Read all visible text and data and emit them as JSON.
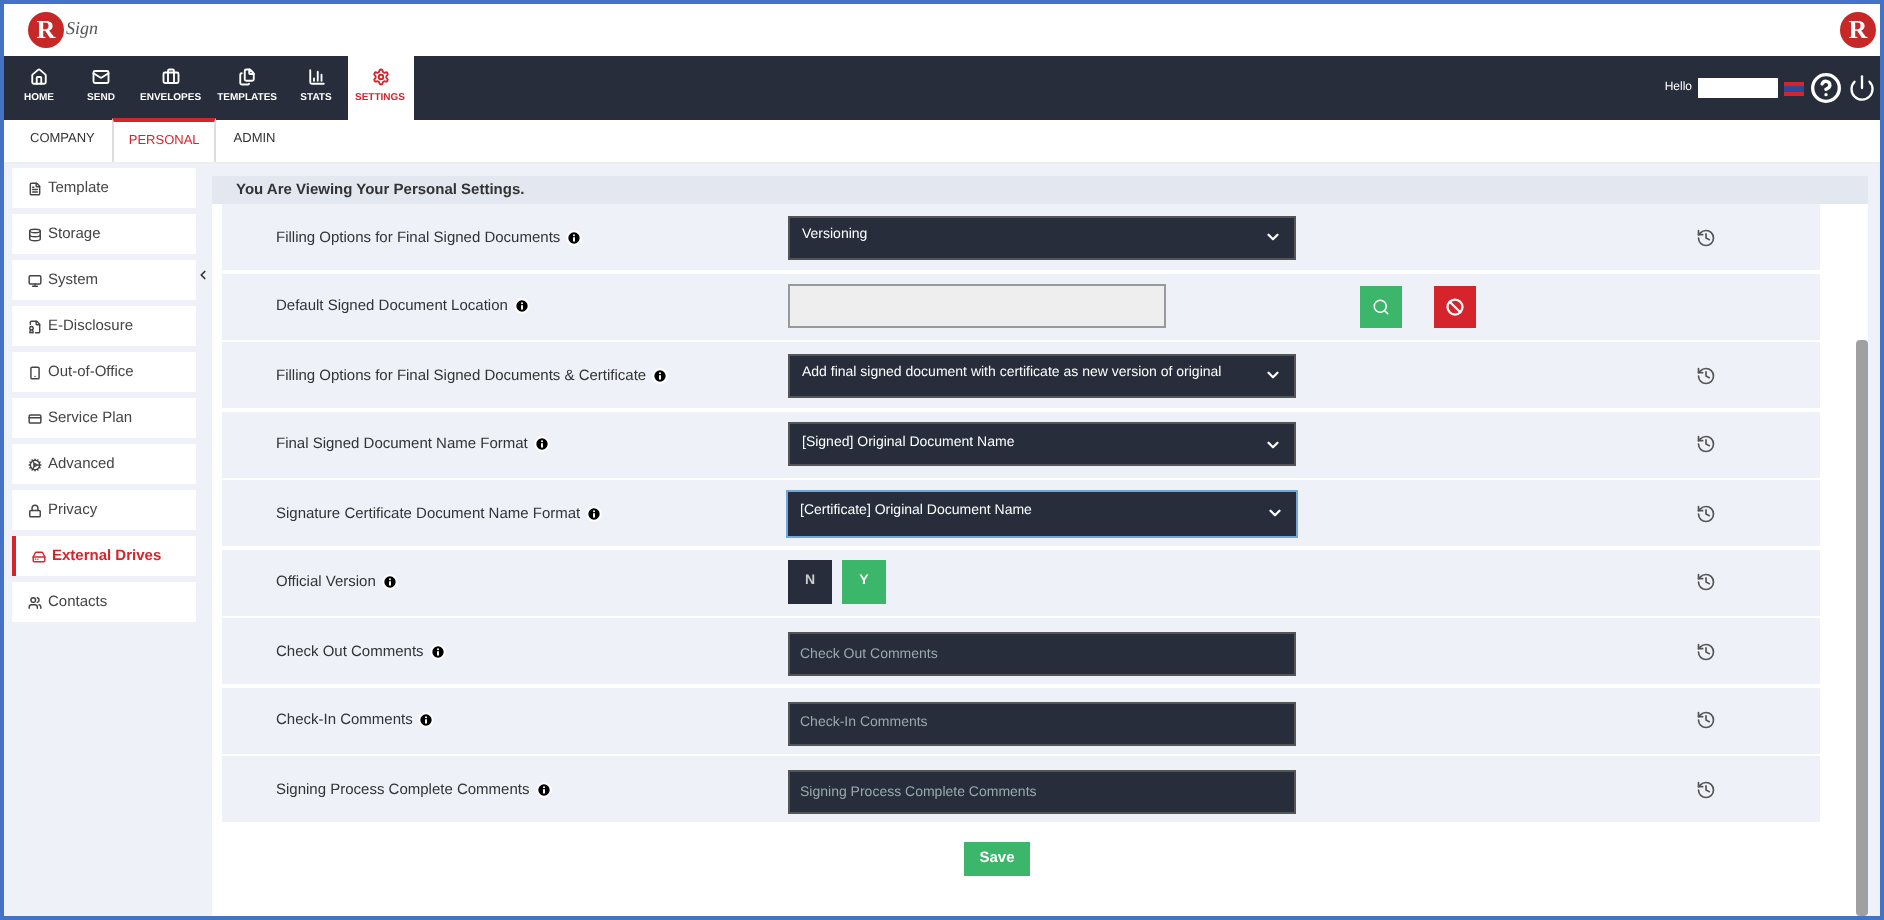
{
  "logo": {
    "mark": "R",
    "word": "Sign"
  },
  "corner_logo": {
    "mark": "R"
  },
  "nav": [
    {
      "label": "HOME",
      "selected": false
    },
    {
      "label": "SEND",
      "selected": false
    },
    {
      "label": "ENVELOPES",
      "selected": false
    },
    {
      "label": "TEMPLATES",
      "selected": false
    },
    {
      "label": "STATS",
      "selected": false
    },
    {
      "label": "SETTINGS",
      "selected": true
    }
  ],
  "user": {
    "greeting": "Hello"
  },
  "tabs": [
    {
      "label": "COMPANY",
      "selected": false
    },
    {
      "label": "PERSONAL",
      "selected": true
    },
    {
      "label": "ADMIN",
      "selected": false
    }
  ],
  "sidebar": {
    "items": [
      {
        "label": "Template",
        "selected": false
      },
      {
        "label": "Storage",
        "selected": false
      },
      {
        "label": "System",
        "selected": false
      },
      {
        "label": "E-Disclosure",
        "selected": false
      },
      {
        "label": "Out-of-Office",
        "selected": false
      },
      {
        "label": "Service Plan",
        "selected": false
      },
      {
        "label": "Advanced",
        "selected": false
      },
      {
        "label": "Privacy",
        "selected": false
      },
      {
        "label": "External Drives",
        "selected": true
      },
      {
        "label": "Contacts",
        "selected": false
      }
    ]
  },
  "settings": {
    "heading": "You Are Viewing Your Personal Settings.",
    "rows": [
      {
        "kind": "select",
        "label": "Filling Options for Final Signed Documents",
        "value": "Versioning",
        "focused": false,
        "history": true
      },
      {
        "kind": "location",
        "label": "Default Signed Document Location",
        "history": false
      },
      {
        "kind": "select",
        "label": "Filling Options for Final Signed Documents & Certificate",
        "value": "Add final signed document with certificate as new version of original",
        "focused": false,
        "history": true
      },
      {
        "kind": "select",
        "label": "Final Signed Document Name Format",
        "value": "[Signed] Original Document Name",
        "focused": false,
        "history": true
      },
      {
        "kind": "select",
        "label": "Signature Certificate Document Name Format",
        "value": "[Certificate] Original Document Name",
        "focused": true,
        "history": true
      },
      {
        "kind": "toggle",
        "label": "Official Version",
        "options": [
          {
            "label": "N",
            "selected": false
          },
          {
            "label": "Y",
            "selected": true
          }
        ],
        "history": true
      },
      {
        "kind": "text",
        "label": "Check Out Comments",
        "placeholder": "Check Out Comments",
        "history": true
      },
      {
        "kind": "text",
        "label": "Check-In Comments",
        "placeholder": "Check-In Comments",
        "history": true
      },
      {
        "kind": "text",
        "label": "Signing Process Complete Comments",
        "placeholder": "Signing Process Complete Comments",
        "history": true
      }
    ],
    "save": "Save"
  }
}
